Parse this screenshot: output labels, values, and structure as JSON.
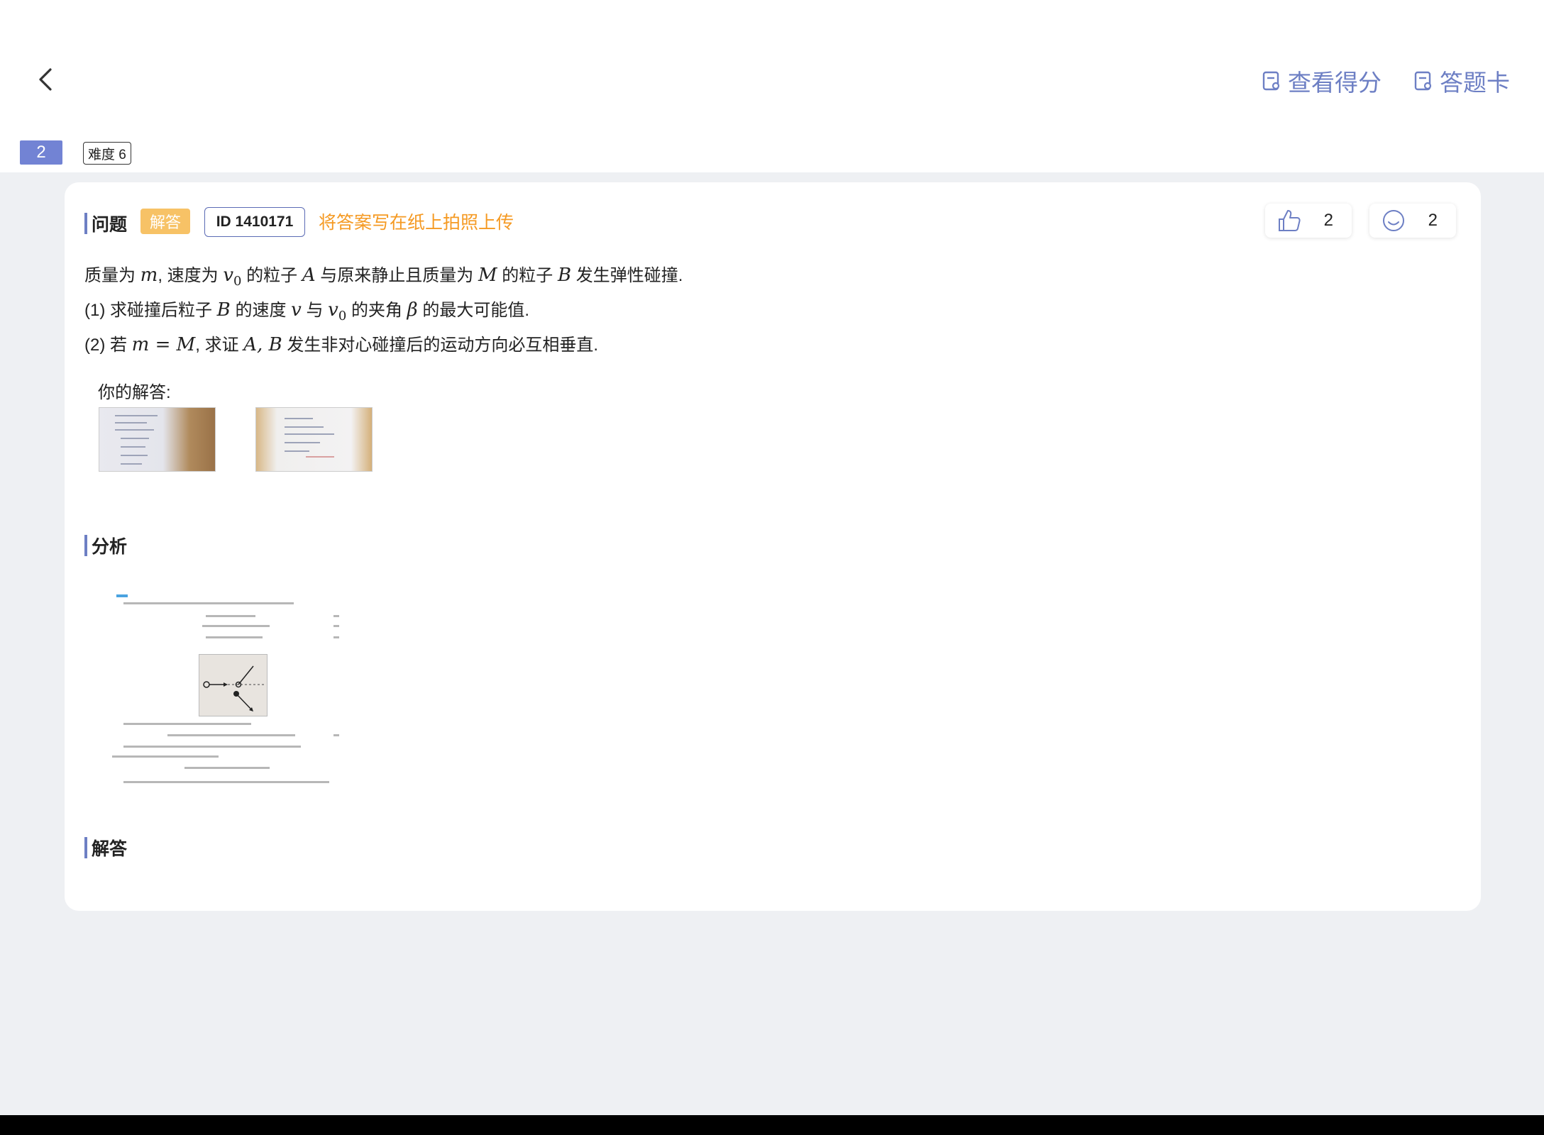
{
  "header": {
    "view_score_label": "查看得分",
    "answer_card_label": "答题卡"
  },
  "question_meta": {
    "number": "2",
    "difficulty": "难度 6"
  },
  "question": {
    "section_title": "问题",
    "type_tag": "解答",
    "id_label": "ID 1410171",
    "upload_hint": "将答案写在纸上拍照上传",
    "likes": "2",
    "comments": "2",
    "lines": [
      [
        "质量为 ",
        "m",
        ", 速度为 ",
        "v0",
        " 的粒子 ",
        "A",
        " 与原来静止且质量为 ",
        "M",
        " 的粒子 ",
        "B",
        " 发生弹性碰撞."
      ],
      [
        "(1) 求碰撞后粒子 ",
        "B",
        " 的速度 ",
        "v",
        " 与 ",
        "v0",
        " 的夹角 ",
        "β",
        " 的最大可能值."
      ],
      [
        "(2) 若 ",
        "m = M",
        ", 求证 ",
        "A, B",
        " 发生非对心碰撞后的运动方向必互相垂直."
      ]
    ],
    "your_answer_label": "你的解答:"
  },
  "analysis": {
    "section_title": "分析"
  },
  "solution": {
    "section_title": "解答"
  },
  "icons": {
    "back": "chevron-left-icon",
    "view_score": "document-icon",
    "answer_card": "document-icon",
    "like": "thumb-up-icon",
    "comment": "smiley-icon"
  },
  "colors": {
    "accent": "#6d7fc4",
    "question_number_bg": "#7283d4",
    "tag_solve_bg": "#f7c266",
    "hint_orange": "#f59a23",
    "page_bg": "#eef0f3"
  }
}
